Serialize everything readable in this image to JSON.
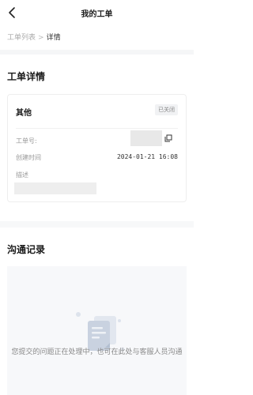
{
  "header": {
    "title": "我的工单",
    "back_icon": "chevron-left-icon"
  },
  "breadcrumb": {
    "parent": "工单列表",
    "separator": ">",
    "current": "详情"
  },
  "detail": {
    "section_title": "工单详情",
    "card": {
      "type": "其他",
      "status": "已关闭",
      "fields": {
        "ticket_no_label": "工单号:",
        "created_label": "创建时间",
        "created_value": "2024-01-21 16:08",
        "desc_label": "描述"
      },
      "copy_icon": "copy-icon"
    }
  },
  "communication": {
    "section_title": "沟通记录",
    "empty_icon": "document-icon",
    "empty_text": "您提交的问题正在处理中，也可在此处与客服人员沟通"
  },
  "colors": {
    "bg": "#ffffff",
    "band": "#f5f6f7",
    "muted_text": "#999999",
    "status_bg": "#f1f2f4"
  }
}
